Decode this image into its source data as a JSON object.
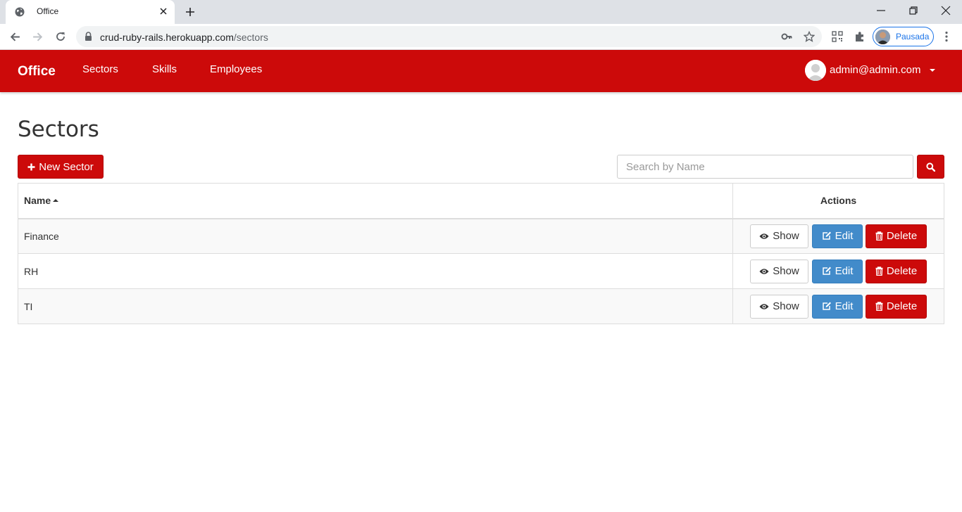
{
  "browser": {
    "tab_title": "Office",
    "url_host": "crud-ruby-rails.herokuapp.com",
    "url_path": "/sectors",
    "profile_label": "Pausada"
  },
  "navbar": {
    "brand": "Office",
    "links": [
      "Sectors",
      "Skills",
      "Employees"
    ],
    "user_email": "admin@admin.com"
  },
  "page": {
    "title": "Sectors",
    "new_button_label": "New Sector",
    "search_placeholder": "Search by Name"
  },
  "table": {
    "headers": {
      "name": "Name",
      "actions": "Actions"
    },
    "rows": [
      {
        "name": "Finance"
      },
      {
        "name": "RH"
      },
      {
        "name": "TI"
      }
    ],
    "action_labels": {
      "show": "Show",
      "edit": "Edit",
      "delete": "Delete"
    }
  },
  "colors": {
    "brand_red": "#cc0a0a",
    "edit_blue": "#428bca"
  },
  "icons": {
    "tab_favicon": "globe-icon",
    "new_button": "plus-icon",
    "search_button": "search-icon",
    "show": "eye-icon",
    "edit": "pencil-square-icon",
    "delete": "trash-icon"
  }
}
